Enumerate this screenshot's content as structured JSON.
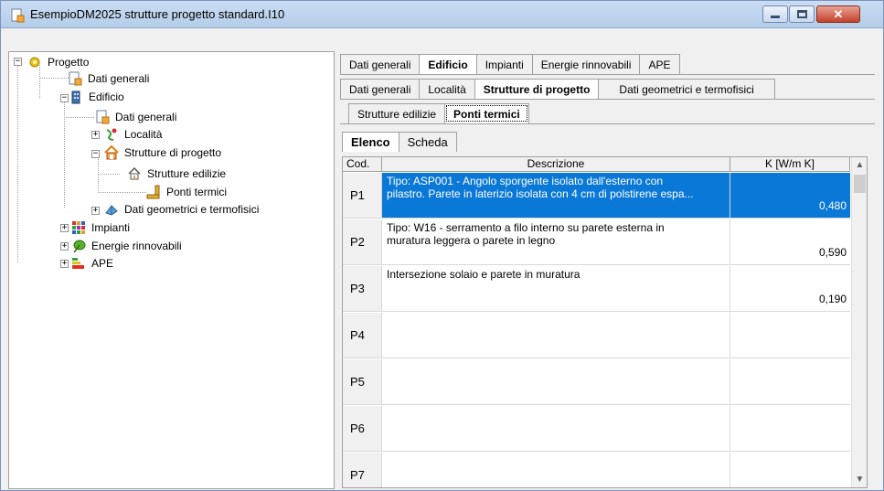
{
  "window": {
    "title": "EsempioDM2025 strutture progetto standard.I10",
    "close_glyph": "✕"
  },
  "tree": {
    "root": "Progetto",
    "dati_generali": "Dati generali",
    "edificio": "Edificio",
    "edificio_dati_generali": "Dati generali",
    "localita": "Località",
    "strutture_di_progetto": "Strutture di progetto",
    "strutture_edilizie": "Strutture edilizie",
    "ponti_termici": "Ponti termici",
    "dati_geometrici": "Dati geometrici e termofisici",
    "impianti": "Impianti",
    "energie_rinnovabili": "Energie rinnovabili",
    "ape": "APE",
    "expander_minus": "−",
    "expander_plus": "+"
  },
  "tabs_level1": [
    "Dati generali",
    "Edificio",
    "Impianti",
    "Energie rinnovabili",
    "APE"
  ],
  "tabs_level2": [
    "Dati generali",
    "Località",
    "Strutture di progetto",
    "Dati geometrici e termofisici"
  ],
  "tabs_level3": [
    "Strutture edilizie",
    "Ponti termici"
  ],
  "tabs_level4": [
    "Elenco",
    "Scheda"
  ],
  "grid": {
    "headers": {
      "code": "Cod.",
      "description": "Descrizione",
      "k": "K [W/m K]"
    },
    "rows": [
      {
        "code": "P1",
        "description": "Tipo: ASP001 - Angolo sporgente isolato dall'esterno con\npilastro. Parete in laterizio isolata con 4 cm di polstirene espa...",
        "k": "0,480"
      },
      {
        "code": "P2",
        "description": "Tipo: W16 - serramento a filo interno su parete esterna in\nmuratura leggera o parete in legno",
        "k": "0,590"
      },
      {
        "code": "P3",
        "description": "Intersezione solaio e parete in muratura",
        "k": "0,190"
      },
      {
        "code": "P4",
        "description": "",
        "k": ""
      },
      {
        "code": "P5",
        "description": "",
        "k": ""
      },
      {
        "code": "P6",
        "description": "",
        "k": ""
      },
      {
        "code": "P7",
        "description": "",
        "k": ""
      }
    ],
    "scroll_up_glyph": "▲",
    "scroll_down_glyph": "▼"
  }
}
